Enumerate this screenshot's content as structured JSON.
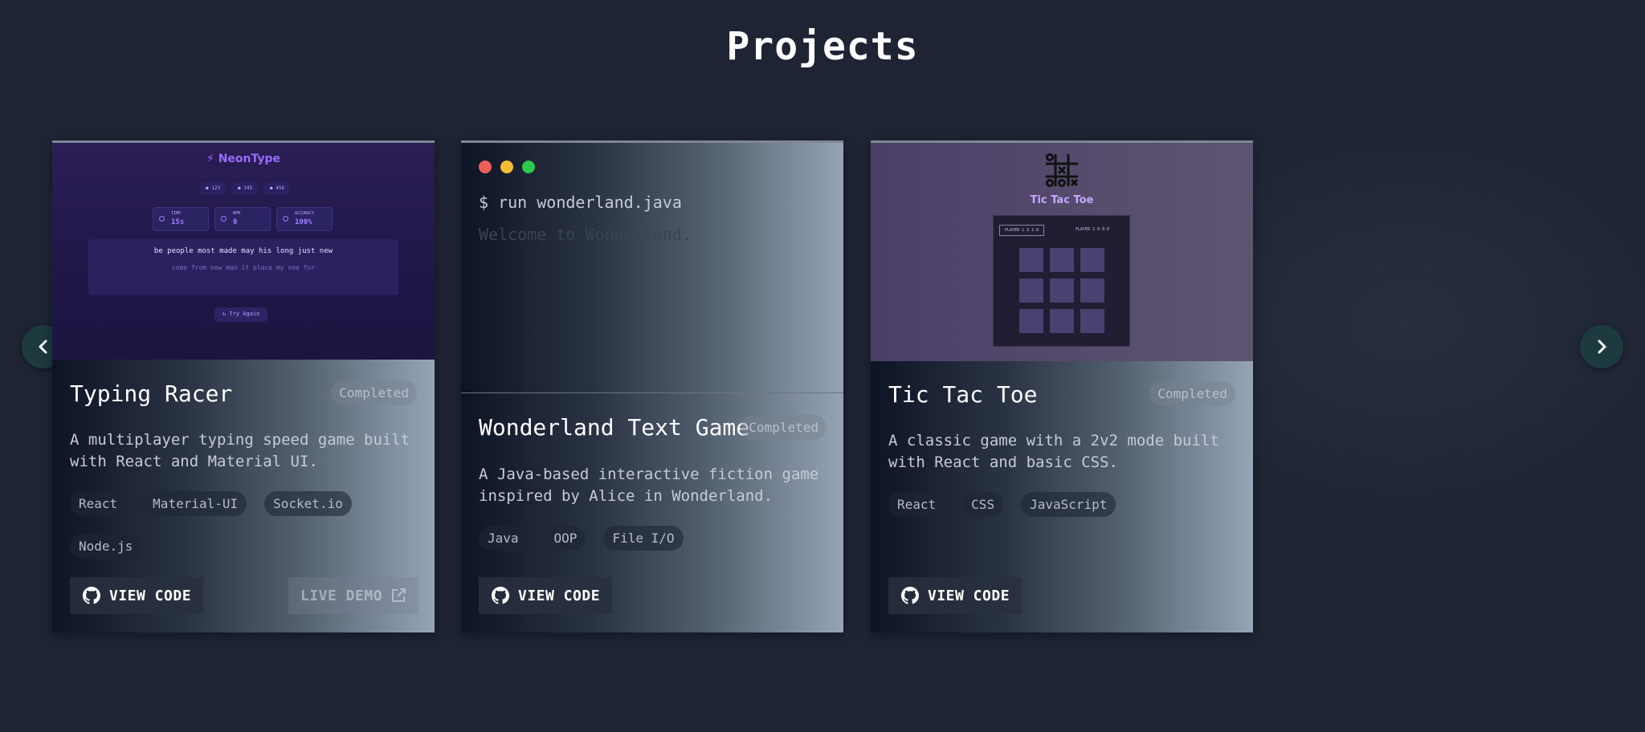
{
  "page": {
    "title": "Projects",
    "colors": {
      "background": "#1e2433",
      "nav_button": "#1d3a3f",
      "accent_purple": "#9a6bff"
    }
  },
  "nav": {
    "prev_icon": "chevron-left-icon",
    "next_icon": "chevron-right-icon"
  },
  "projects": [
    {
      "title": "Typing Racer",
      "status": "Completed",
      "description_line1": "A multiplayer typing speed game built",
      "description_line2": "with React and Material UI.",
      "tags": [
        "React",
        "Material-UI",
        "Socket.io",
        "Node.js"
      ],
      "view_code_label": "VIEW CODE",
      "live_demo_label": "LIVE DEMO",
      "preview": {
        "app_name": "NeonType",
        "pills": [
          "123",
          "345",
          "456"
        ],
        "stats": [
          {
            "label": "TIME",
            "value": "15s"
          },
          {
            "label": "WPM",
            "value": "0"
          },
          {
            "label": "ACCURACY",
            "value": "100%"
          }
        ],
        "text_line1": "be people most made may his long just new",
        "text_line2": "come from new man it place my see for",
        "try_again": "Try Again"
      }
    },
    {
      "title": "Wonderland Text Game",
      "status": "Completed",
      "description_line1": "A Java-based interactive fiction game",
      "description_line2": "inspired by Alice in Wonderland.",
      "tags": [
        "Java",
        "OOP",
        "File I/O"
      ],
      "view_code_label": "VIEW CODE",
      "preview": {
        "command": "$ run wonderland.java",
        "output": "Welcome to Wonderland.",
        "window_dots": [
          "#ed5f57",
          "#f4bd31",
          "#2fc84a"
        ]
      }
    },
    {
      "title": "Tic Tac Toe",
      "status": "Completed",
      "description_line1": "A classic game with a 2v2 mode built",
      "description_line2": "with React and basic CSS.",
      "tags": [
        "React",
        "CSS",
        "JavaScript"
      ],
      "view_code_label": "VIEW CODE",
      "preview": {
        "app_name": "Tic Tac Toe",
        "player1": "PLAYER 1  X  1-0",
        "player2": "PLAYER 2  O  0-0"
      }
    }
  ]
}
